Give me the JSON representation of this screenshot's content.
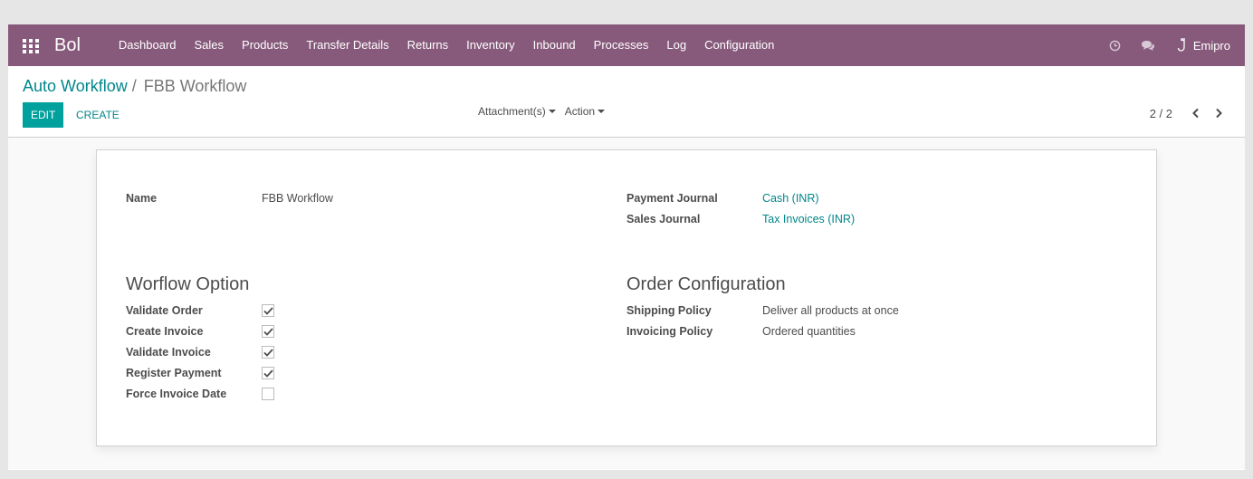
{
  "navbar": {
    "brand": "Bol",
    "menu": [
      "Dashboard",
      "Sales",
      "Products",
      "Transfer Details",
      "Returns",
      "Inventory",
      "Inbound",
      "Processes",
      "Log",
      "Configuration"
    ],
    "user": "Emipro",
    "icons": [
      "apps-grid-icon",
      "clock-icon",
      "chat-icon",
      "user-icon"
    ],
    "color": "#875a7b"
  },
  "breadcrumb": {
    "parent": "Auto Workflow",
    "separator": "/",
    "current": "FBB Workflow"
  },
  "buttons": {
    "edit": "EDIT",
    "create": "CREATE"
  },
  "dropdowns": {
    "attachments": "Attachment(s)",
    "action": "Action"
  },
  "pager": {
    "value": "2 / 2"
  },
  "form": {
    "name_label": "Name",
    "name_value": "FBB Workflow",
    "payment_journal_label": "Payment Journal",
    "payment_journal_value": "Cash (INR)",
    "sales_journal_label": "Sales Journal",
    "sales_journal_value": "Tax Invoices (INR)",
    "workflow_title": "Worflow Option",
    "options": [
      {
        "label": "Validate Order",
        "checked": true
      },
      {
        "label": "Create Invoice",
        "checked": true
      },
      {
        "label": "Validate Invoice",
        "checked": true
      },
      {
        "label": "Register Payment",
        "checked": true
      },
      {
        "label": "Force Invoice Date",
        "checked": false
      }
    ],
    "order_title": "Order Configuration",
    "shipping_label": "Shipping Policy",
    "shipping_value": "Deliver all products at once",
    "invoicing_label": "Invoicing Policy",
    "invoicing_value": "Ordered quantities"
  },
  "colors": {
    "accent": "#00a09d",
    "link": "#00868b"
  }
}
